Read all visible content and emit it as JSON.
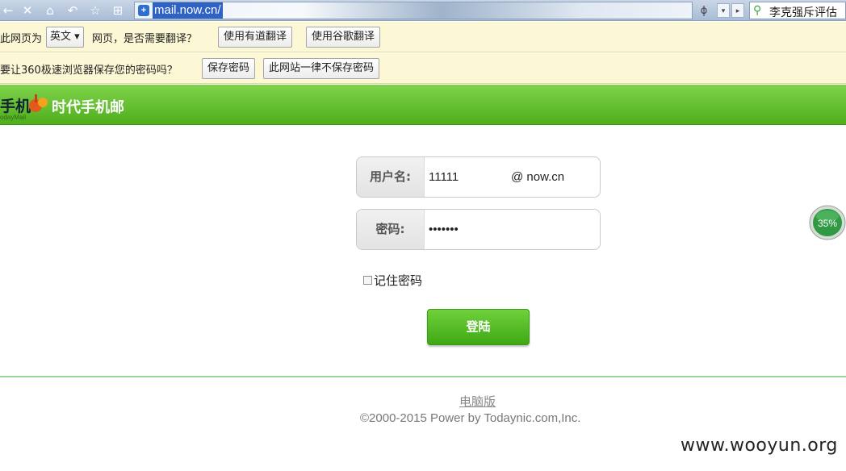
{
  "browser": {
    "url": "mail.now.cn/",
    "search_text": "李克强斥评估",
    "nav_icons": [
      "back-icon",
      "close-icon",
      "home-icon",
      "undo-icon",
      "star-icon",
      "grid-icon"
    ]
  },
  "translate_bar": {
    "prefix": "此网页为",
    "language": "英文",
    "question": "网页，是否需要翻译？",
    "youdao_button": "使用有道翻译",
    "google_button": "使用谷歌翻译"
  },
  "password_bar": {
    "question": "要让360极速浏览器保存您的密码吗？",
    "save_button": "保存密码",
    "never_button": "此网站一律不保存密码"
  },
  "header": {
    "logo_text": "手机",
    "logo_sub": "odayMail",
    "title": "时代手机邮"
  },
  "login": {
    "username_label": "用户名:",
    "username_value": "11111",
    "domain_suffix": "@ now.cn",
    "password_label": "密码:",
    "password_value": "1234567",
    "remember_label": "记住密码",
    "submit_label": "登陆"
  },
  "footer": {
    "desktop_link": "电脑版",
    "copyright": "©2000-2015 Power by Todaynic.com,Inc."
  },
  "badge": {
    "percent": "35%"
  },
  "watermark": "www.wooyun.org",
  "colors": {
    "accent_green": "#4fae1d",
    "button_green": "#3ea813",
    "infobar_bg": "#fcf7d5"
  }
}
